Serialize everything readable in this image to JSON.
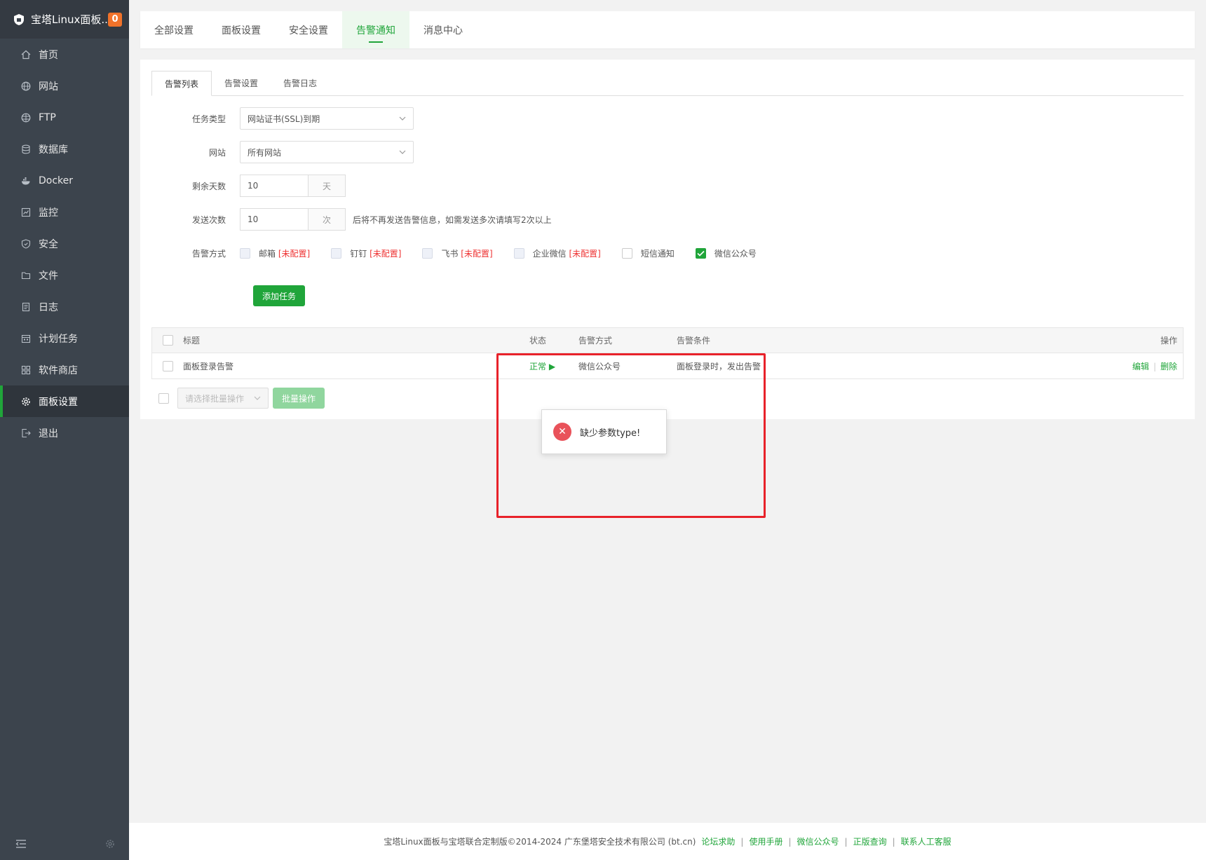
{
  "sidebar": {
    "brand": "宝塔Linux面板...",
    "badge": "0",
    "items": [
      {
        "label": "首页"
      },
      {
        "label": "网站"
      },
      {
        "label": "FTP"
      },
      {
        "label": "数据库"
      },
      {
        "label": "Docker"
      },
      {
        "label": "监控"
      },
      {
        "label": "安全"
      },
      {
        "label": "文件"
      },
      {
        "label": "日志"
      },
      {
        "label": "计划任务"
      },
      {
        "label": "软件商店"
      },
      {
        "label": "面板设置"
      },
      {
        "label": "退出"
      }
    ],
    "active_index": 11
  },
  "top_tabs": [
    "全部设置",
    "面板设置",
    "安全设置",
    "告警通知",
    "消息中心"
  ],
  "sub_tabs": [
    "告警列表",
    "告警设置",
    "告警日志"
  ],
  "form": {
    "task_type_label": "任务类型",
    "task_type_value": "网站证书(SSL)到期",
    "site_label": "网站",
    "site_value": "所有网站",
    "days_label": "剩余天数",
    "days_value": "10",
    "days_unit": "天",
    "count_label": "发送次数",
    "count_value": "10",
    "count_unit": "次",
    "count_hint": "后将不再发送告警信息，如需发送多次请填写2次以上",
    "method_label": "告警方式",
    "methods": [
      {
        "name": "邮箱",
        "note": "[未配置]"
      },
      {
        "name": "钉钉",
        "note": "[未配置]"
      },
      {
        "name": "飞书",
        "note": "[未配置]"
      },
      {
        "name": "企业微信",
        "note": "[未配置]"
      },
      {
        "name": "短信通知",
        "note": ""
      },
      {
        "name": "微信公众号",
        "note": ""
      }
    ],
    "add_button": "添加任务"
  },
  "table": {
    "headers": {
      "title": "标题",
      "status": "状态",
      "method": "告警方式",
      "condition": "告警条件",
      "op": "操作"
    },
    "rows": [
      {
        "title": "面板登录告警",
        "status": "正常",
        "method": "微信公众号",
        "condition": "面板登录时，发出告警",
        "edit": "编辑",
        "delete": "删除"
      }
    ]
  },
  "batch": {
    "placeholder": "请选择批量操作",
    "button": "批量操作"
  },
  "toast": {
    "message": "缺少参数type!"
  },
  "footer": {
    "copyright": "宝塔Linux面板与宝塔联合定制版©2014-2024 广东堡塔安全技术有限公司 (bt.cn)",
    "links": [
      "论坛求助",
      "使用手册",
      "微信公众号",
      "正版查询",
      "联系人工客服"
    ]
  }
}
